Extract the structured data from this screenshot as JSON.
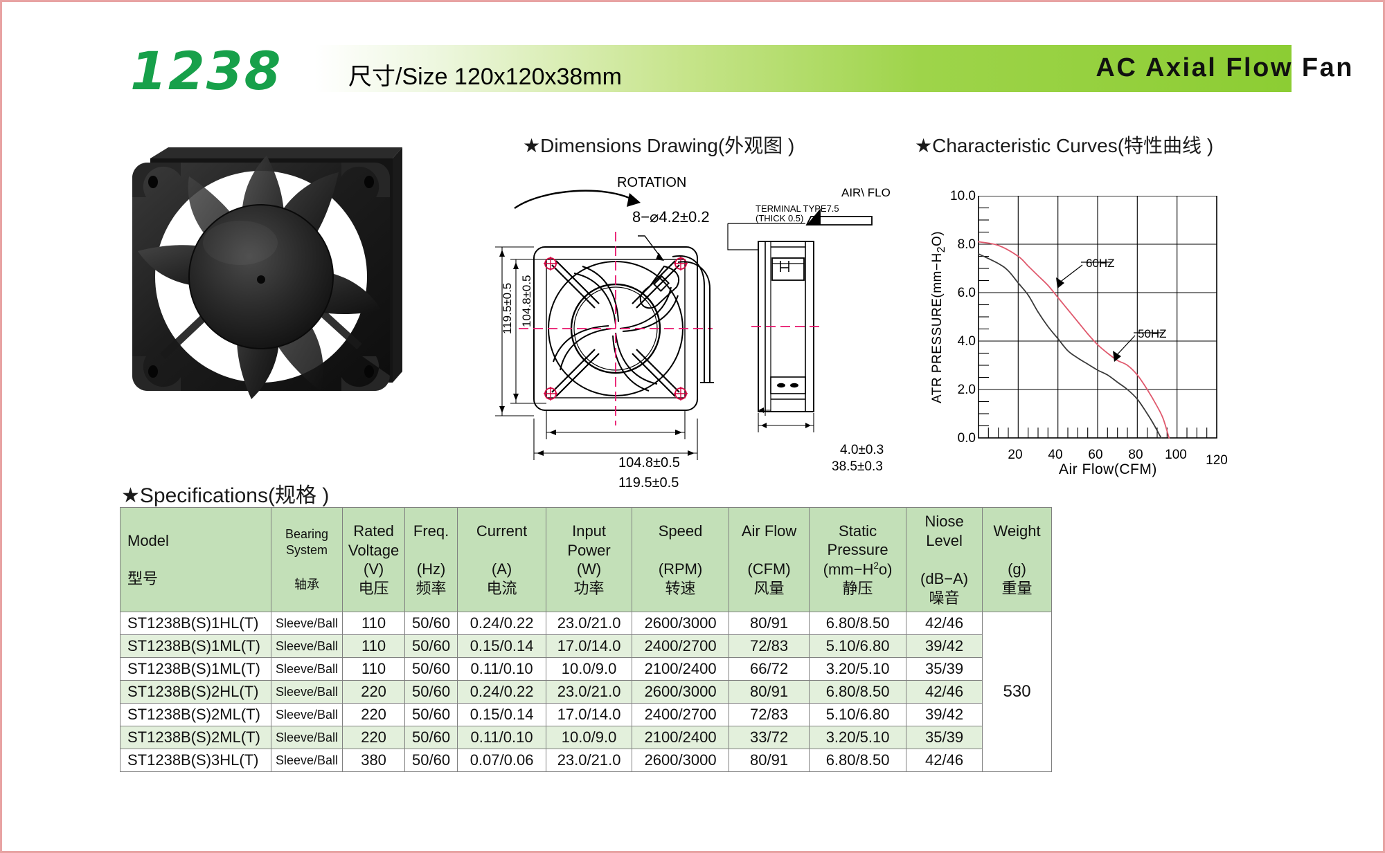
{
  "header": {
    "model_number": "1238",
    "size_text": "尺寸/Size 120x120x38mm",
    "product_title": "AC Axial Flow Fan",
    "band_color_start": "#ffffff",
    "band_color_end": "#8ccd33",
    "model_color": "#17a04a"
  },
  "sections": {
    "dimensions_title": "★Dimensions Drawing(外观图 )",
    "curves_title": "★Characteristic Curves(特性曲线 )",
    "specs_title": "★Specifications(规格 )"
  },
  "drawing": {
    "rotation_label": "ROTATION",
    "hole_spec": "8−⌀4.2±0.2",
    "terminal_type": "TERMINAL TYPE7.5",
    "terminal_thick": "(THICK 0.5)",
    "air_flow_label": "AIR\\ FLO",
    "width_outer": "119.5±0.5",
    "width_inner": "104.8±0.5",
    "height_outer": "119.5±0.5",
    "height_inner": "104.8±0.5",
    "depth_total": "38.5±0.3",
    "depth_flange": "4.0±0.3"
  },
  "chart_data": {
    "type": "line",
    "title": "",
    "xlabel": "Air Flow(CFM)",
    "ylabel": "ATR PRESSURE(mm−H2O)",
    "ylabel_parts": {
      "pre": "ATR PRESSURE(mm−H",
      "sub": "2",
      "post": "O)"
    },
    "xlim": [
      0,
      120
    ],
    "ylim": [
      0.0,
      10.0
    ],
    "xticks": [
      20,
      40,
      60,
      80,
      100,
      120
    ],
    "yticks": [
      "0.0",
      "2.0",
      "4.0",
      "6.0",
      "8.0",
      "10.0"
    ],
    "grid": true,
    "legend_position": "inline-annotation",
    "series": [
      {
        "name": "60HZ",
        "color": "#e05a6e",
        "points": [
          [
            0,
            8.1
          ],
          [
            10,
            7.95
          ],
          [
            20,
            7.5
          ],
          [
            25,
            7.1
          ],
          [
            30,
            6.7
          ],
          [
            35,
            6.3
          ],
          [
            40,
            5.8
          ],
          [
            45,
            5.3
          ],
          [
            50,
            4.8
          ],
          [
            55,
            4.3
          ],
          [
            60,
            3.85
          ],
          [
            65,
            3.5
          ],
          [
            70,
            3.2
          ],
          [
            75,
            3.0
          ],
          [
            80,
            2.6
          ],
          [
            85,
            2.0
          ],
          [
            90,
            1.3
          ],
          [
            93,
            0.8
          ],
          [
            96,
            0.0
          ]
        ]
      },
      {
        "name": "50HZ",
        "color": "#3a3a3a",
        "points": [
          [
            0,
            7.6
          ],
          [
            10,
            7.2
          ],
          [
            15,
            6.9
          ],
          [
            20,
            6.4
          ],
          [
            25,
            5.9
          ],
          [
            30,
            5.2
          ],
          [
            35,
            4.6
          ],
          [
            40,
            4.1
          ],
          [
            45,
            3.6
          ],
          [
            50,
            3.3
          ],
          [
            55,
            3.05
          ],
          [
            60,
            2.8
          ],
          [
            65,
            2.6
          ],
          [
            70,
            2.3
          ],
          [
            75,
            2.0
          ],
          [
            80,
            1.6
          ],
          [
            85,
            1.0
          ],
          [
            88,
            0.6
          ],
          [
            92,
            0.0
          ]
        ]
      }
    ],
    "annotations": [
      {
        "text": "60HZ",
        "x": 52,
        "y": 7.0
      },
      {
        "text": "50HZ",
        "x": 74,
        "y": 4.6
      }
    ]
  },
  "table": {
    "headers": [
      {
        "en": "Model",
        "unit": "",
        "cn": "型号"
      },
      {
        "en": "Bearing System",
        "unit": "",
        "cn": "轴承"
      },
      {
        "en": "Rated Voltage",
        "unit": "(V)",
        "cn": "电压"
      },
      {
        "en": "Freq.",
        "unit": "(Hz)",
        "cn": "频率"
      },
      {
        "en": "Current",
        "unit": "(A)",
        "cn": "电流"
      },
      {
        "en": "Input Power",
        "unit": "(W)",
        "cn": "功率"
      },
      {
        "en": "Speed",
        "unit": "(RPM)",
        "cn": "转速"
      },
      {
        "en": "Air Flow",
        "unit": "(CFM)",
        "cn": "风量"
      },
      {
        "en": "Static Pressure",
        "unit": "(mm−H2o)",
        "cn": "静压"
      },
      {
        "en": "Niose Level",
        "unit": "(dB−A)",
        "cn": "噪音"
      },
      {
        "en": "Weight",
        "unit": "(g)",
        "cn": "重量"
      }
    ],
    "rows": [
      {
        "model": "ST1238B(S)1HL(T)",
        "bearing": "Sleeve/Ball",
        "voltage": "110",
        "freq": "50/60",
        "current": "0.24/0.22",
        "power": "23.0/21.0",
        "speed": "2600/3000",
        "airflow": "80/91",
        "static": "6.80/8.50",
        "noise": "42/46"
      },
      {
        "model": "ST1238B(S)1ML(T)",
        "bearing": "Sleeve/Ball",
        "voltage": "110",
        "freq": "50/60",
        "current": "0.15/0.14",
        "power": "17.0/14.0",
        "speed": "2400/2700",
        "airflow": "72/83",
        "static": "5.10/6.80",
        "noise": "39/42"
      },
      {
        "model": "ST1238B(S)1ML(T)",
        "bearing": "Sleeve/Ball",
        "voltage": "110",
        "freq": "50/60",
        "current": "0.11/0.10",
        "power": "10.0/9.0",
        "speed": "2100/2400",
        "airflow": "66/72",
        "static": "3.20/5.10",
        "noise": "35/39"
      },
      {
        "model": "ST1238B(S)2HL(T)",
        "bearing": "Sleeve/Ball",
        "voltage": "220",
        "freq": "50/60",
        "current": "0.24/0.22",
        "power": "23.0/21.0",
        "speed": "2600/3000",
        "airflow": "80/91",
        "static": "6.80/8.50",
        "noise": "42/46"
      },
      {
        "model": "ST1238B(S)2ML(T)",
        "bearing": "Sleeve/Ball",
        "voltage": "220",
        "freq": "50/60",
        "current": "0.15/0.14",
        "power": "17.0/14.0",
        "speed": "2400/2700",
        "airflow": "72/83",
        "static": "5.10/6.80",
        "noise": "39/42"
      },
      {
        "model": "ST1238B(S)2ML(T)",
        "bearing": "Sleeve/Ball",
        "voltage": "220",
        "freq": "50/60",
        "current": "0.11/0.10",
        "power": "10.0/9.0",
        "speed": "2100/2400",
        "airflow": "33/72",
        "static": "3.20/5.10",
        "noise": "35/39"
      },
      {
        "model": "ST1238B(S)3HL(T)",
        "bearing": "Sleeve/Ball",
        "voltage": "380",
        "freq": "50/60",
        "current": "0.07/0.06",
        "power": "23.0/21.0",
        "speed": "2600/3000",
        "airflow": "80/91",
        "static": "6.80/8.50",
        "noise": "42/46"
      }
    ],
    "weight_value": "530"
  }
}
